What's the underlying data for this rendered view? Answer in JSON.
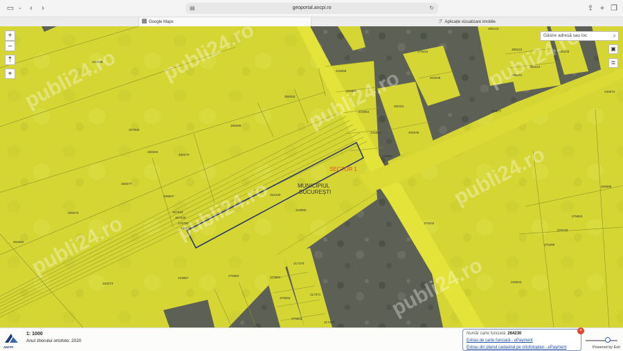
{
  "browser": {
    "url": "geoportal.ancpi.ro",
    "tabs": [
      {
        "label": "Google Maps"
      },
      {
        "label": "Aplicație vizualizare imobile"
      }
    ]
  },
  "map": {
    "search_placeholder": "Găsire adresă sau loc",
    "controls": {
      "zoom_in": "+",
      "zoom_out": "–"
    },
    "overlay_labels": {
      "sector": "SECTOR 1",
      "municipality_line1": "MUNICIPIUL",
      "municipality_line2": "BUCUREȘTI"
    },
    "watermark": "publi24.ro",
    "colors": {
      "parcel_fill": "#d6d632",
      "road": "#e2e236",
      "boundary": "#2b3a6b",
      "sector_label": "#e0502a"
    },
    "parcels": [
      "206936",
      "207030",
      "250263",
      "250270",
      "259277",
      "208937",
      "259270",
      "203492",
      "267234",
      "267240",
      "276750",
      "267244",
      "263273",
      "218957",
      "276984",
      "218950",
      "264230",
      "258280",
      "258282",
      "242866",
      "242855",
      "242854",
      "242853",
      "242852",
      "260311",
      "202046",
      "276342",
      "202048",
      "285223",
      "285222",
      "285221",
      "285224",
      "285233",
      "230570",
      "278977",
      "270102",
      "206999",
      "275863",
      "278130",
      "275468",
      "225623",
      "217370",
      "270831",
      "270832",
      "270833",
      "217371",
      "217373"
    ]
  },
  "footer": {
    "scale": "1: 1000",
    "ortho_year": "Anul zborului ortofoto: 2020",
    "logo_text": "ANCPI",
    "popup": {
      "number_label": "Număr carte funciară:",
      "number_value": "264230",
      "link1": "Extras de carte funciară - ePayment",
      "link2": "Extras din planul cadastral pe ortofotoplan - ePayment",
      "close": "×"
    },
    "powered_by": "Powered by Esri"
  }
}
